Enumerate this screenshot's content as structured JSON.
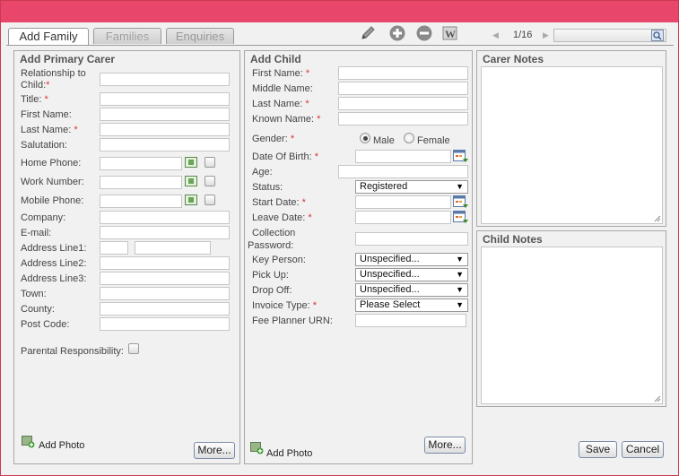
{
  "tabs": [
    "Add Family",
    "Families",
    "Enquiries"
  ],
  "toolbar": {
    "edit_icon": "pencil-icon",
    "add_icon": "plus-circle-icon",
    "remove_icon": "minus-circle-icon",
    "word_icon": "word-document-icon"
  },
  "pager": {
    "prev": "◀",
    "next": "▶",
    "text": "1/16",
    "search_placeholder": ""
  },
  "primary_carer": {
    "title": "Add Primary Carer",
    "labels": {
      "relationship_line1": "Relationship to",
      "relationship_line2": "Child:",
      "title": "Title:",
      "first_name": "First Name:",
      "last_name": "Last Name:",
      "salutation": "Salutation:",
      "home_phone": "Home Phone:",
      "work_number": "Work Number:",
      "mobile_phone": "Mobile Phone:",
      "company": "Company:",
      "email": "E-mail:",
      "address1": "Address Line1:",
      "address2": "Address Line2:",
      "address3": "Address Line3:",
      "town": "Town:",
      "county": "County:",
      "postcode": "Post Code:",
      "parental": "Parental Responsibility:"
    },
    "add_photo": "Add Photo",
    "more": "More..."
  },
  "child": {
    "title": "Add Child",
    "labels": {
      "first_name": "First Name:",
      "middle_name": "Middle Name:",
      "last_name": "Last Name:",
      "known_name": "Known Name:",
      "gender": "Gender:",
      "male": "Male",
      "female": "Female",
      "dob": "Date Of Birth:",
      "age": "Age:",
      "status": "Status:",
      "start_date": "Start Date:",
      "leave_date": "Leave Date:",
      "collection_line1": "Collection",
      "collection_line2": "Password:",
      "key_person": "Key Person:",
      "pick_up": "Pick Up:",
      "drop_off": "Drop Off:",
      "invoice_type": "Invoice Type:",
      "fee_planner": "Fee Planner URN:"
    },
    "values": {
      "status": "Registered",
      "key_person": "Unspecified...",
      "pick_up": "Unspecified...",
      "drop_off": "Unspecified...",
      "invoice_type": "Please Select",
      "gender_selected": "Male"
    },
    "add_photo": "Add Photo",
    "more": "More..."
  },
  "notes": {
    "carer": "Carer Notes",
    "child": "Child Notes"
  },
  "actions": {
    "save": "Save",
    "cancel": "Cancel"
  },
  "required_mark": "*",
  "colors": {
    "titlebar": "#e8466a",
    "required": "#dd3333"
  }
}
